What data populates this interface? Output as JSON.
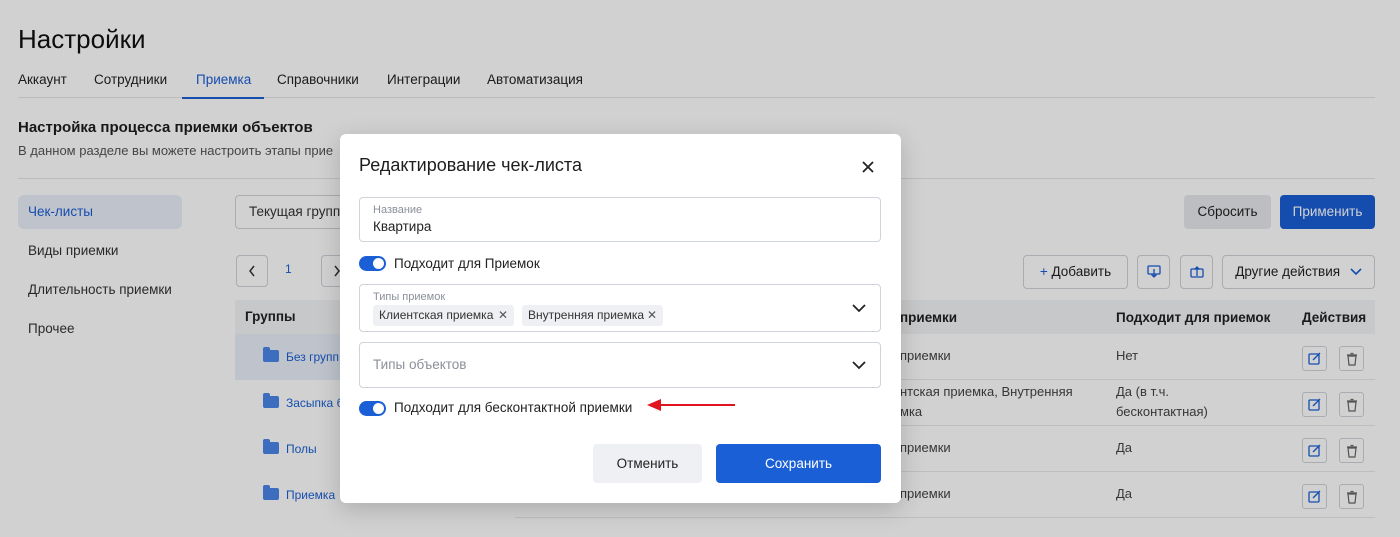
{
  "page": {
    "title": "Настройки",
    "tabs": [
      "Аккаунт",
      "Сотрудники",
      "Приемка",
      "Справочники",
      "Интеграции",
      "Автоматизация"
    ],
    "section_title": "Настройка процесса приемки объектов",
    "section_subtitle": "В данном разделе вы можете настроить этапы прие"
  },
  "sidebar": {
    "items": [
      "Чек-листы",
      "Виды приемки",
      "Длительность приемки",
      "Прочее"
    ]
  },
  "toolbar": {
    "group_select": "Текущая групп",
    "reset": "Сбросить",
    "apply": "Применить",
    "add": "Добавить",
    "other_actions": "Другие действия"
  },
  "pagination": {
    "current_page": "1"
  },
  "groups": {
    "header": "Группы",
    "rows": [
      "Без групп",
      "Засыпка б",
      "Полы",
      "Приемка"
    ]
  },
  "table": {
    "headers": [
      "приемки",
      "Подходит для приемок",
      "Действия"
    ],
    "rows": [
      {
        "type": "приемки",
        "suits": "Нет",
        "suits2": ""
      },
      {
        "type": "нтская приемка, Внутренняя",
        "type2": "мка",
        "suits": "Да (в т.ч.",
        "suits2": "бесконтактная)"
      },
      {
        "type": "приемки",
        "suits": "Да",
        "suits2": ""
      },
      {
        "type": "приемки",
        "suits": "Да",
        "suits2": ""
      }
    ]
  },
  "modal": {
    "title": "Редактирование чек-листа",
    "name_label": "Название",
    "name_value": "Квартира",
    "toggle_1_label": "Подходит для Приемок",
    "types_label": "Типы приемок",
    "types_chips": [
      "Клиентская приемка",
      "Внутренняя приемка"
    ],
    "object_types_placeholder": "Типы объектов",
    "toggle_2_label": "Подходит для бесконтактной приемки",
    "cancel": "Отменить",
    "save": "Сохранить"
  },
  "colors": {
    "accent": "#1a5fd6",
    "arrow": "#e0141e"
  }
}
